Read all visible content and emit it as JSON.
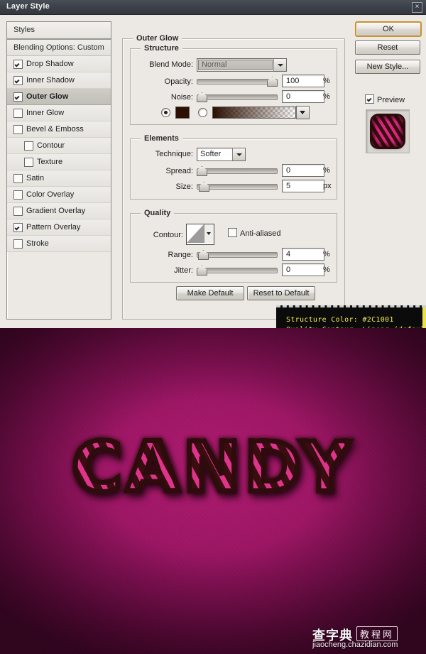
{
  "window": {
    "title": "Layer Style",
    "close_label": "×"
  },
  "sidebar": {
    "header": "Styles",
    "blending_options": "Blending Options: Custom",
    "items": [
      {
        "label": "Drop Shadow",
        "checked": true,
        "selected": false,
        "indent": false
      },
      {
        "label": "Inner Shadow",
        "checked": true,
        "selected": false,
        "indent": false
      },
      {
        "label": "Outer Glow",
        "checked": true,
        "selected": true,
        "indent": false
      },
      {
        "label": "Inner Glow",
        "checked": false,
        "selected": false,
        "indent": false
      },
      {
        "label": "Bevel & Emboss",
        "checked": false,
        "selected": false,
        "indent": false
      },
      {
        "label": "Contour",
        "checked": false,
        "selected": false,
        "indent": true
      },
      {
        "label": "Texture",
        "checked": false,
        "selected": false,
        "indent": true
      },
      {
        "label": "Satin",
        "checked": false,
        "selected": false,
        "indent": false
      },
      {
        "label": "Color Overlay",
        "checked": false,
        "selected": false,
        "indent": false
      },
      {
        "label": "Gradient Overlay",
        "checked": false,
        "selected": false,
        "indent": false
      },
      {
        "label": "Pattern Overlay",
        "checked": true,
        "selected": false,
        "indent": false
      },
      {
        "label": "Stroke",
        "checked": false,
        "selected": false,
        "indent": false
      }
    ]
  },
  "buttons": {
    "ok": "OK",
    "reset": "Reset",
    "new_style": "New Style...",
    "preview": "Preview",
    "make_default": "Make Default",
    "reset_to_default": "Reset to Default"
  },
  "panel": {
    "title": "Outer Glow",
    "structure": {
      "legend": "Structure",
      "blend_mode_label": "Blend Mode:",
      "blend_mode_value": "Normal",
      "opacity_label": "Opacity:",
      "opacity_value": "100",
      "opacity_unit": "%",
      "noise_label": "Noise:",
      "noise_value": "0",
      "noise_unit": "%",
      "color_hex": "#2C1001"
    },
    "elements": {
      "legend": "Elements",
      "technique_label": "Technique:",
      "technique_value": "Softer",
      "spread_label": "Spread:",
      "spread_value": "0",
      "spread_unit": "%",
      "size_label": "Size:",
      "size_value": "5",
      "size_unit": "px"
    },
    "quality": {
      "legend": "Quality",
      "contour_label": "Contour:",
      "anti_aliased_label": "Anti-aliased",
      "anti_aliased_checked": false,
      "range_label": "Range:",
      "range_value": "4",
      "range_unit": "%",
      "jitter_label": "Jitter:",
      "jitter_value": "0",
      "jitter_unit": "%"
    }
  },
  "tooltip": {
    "line1": "Structure Color: #2C1001",
    "line2": "Quality Contour: Linear (default)",
    "text_color": "#f2ea52",
    "background": "#0b0b0b"
  },
  "artwork": {
    "text": "CANDY",
    "stripe_pink": "#e0348c",
    "stripe_dark": "#3a0d11",
    "background_center": "#ad1a6f",
    "background_edge": "#45062b"
  },
  "watermark": {
    "brand": "查字典",
    "tag": "教程网",
    "url": "jiaocheng.chazidian.com"
  }
}
